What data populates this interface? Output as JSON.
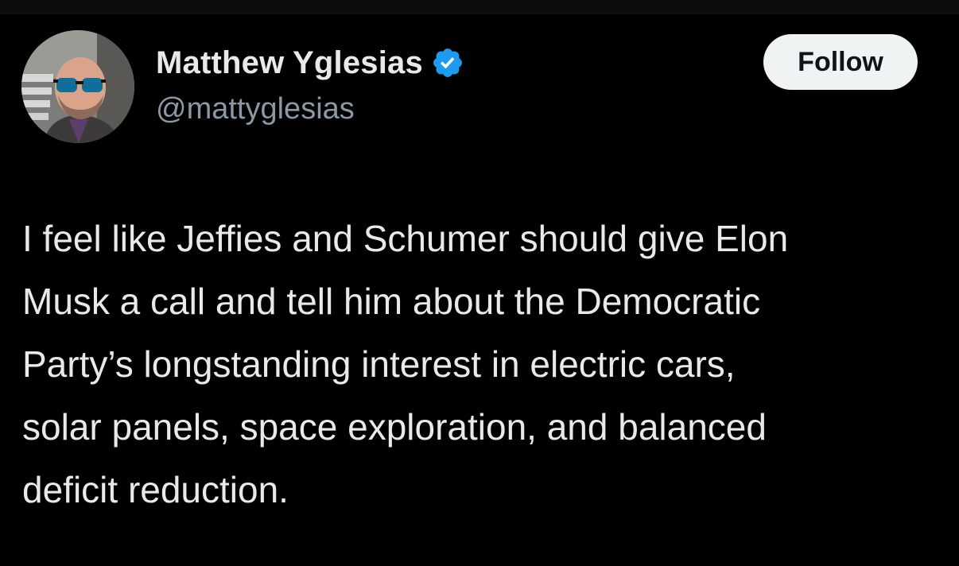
{
  "author": {
    "display_name": "Matthew Yglesias",
    "handle": "@mattyglesias",
    "verified_icon": "verified-badge-icon",
    "avatar_icon": "avatar-photo"
  },
  "actions": {
    "follow_label": "Follow"
  },
  "tweet": {
    "lines": [
      "I feel like Jeffies and Schumer should give Elon",
      "Musk a call and tell him about the Democratic",
      "Party’s longstanding interest in electric cars,",
      "solar panels, space exploration, and balanced",
      "deficit reduction."
    ]
  },
  "colors": {
    "background": "#000000",
    "text_primary": "#e7e9ea",
    "text_secondary": "#8b98a5",
    "verified_blue": "#1d9bf0",
    "follow_bg": "#eff3f4"
  }
}
